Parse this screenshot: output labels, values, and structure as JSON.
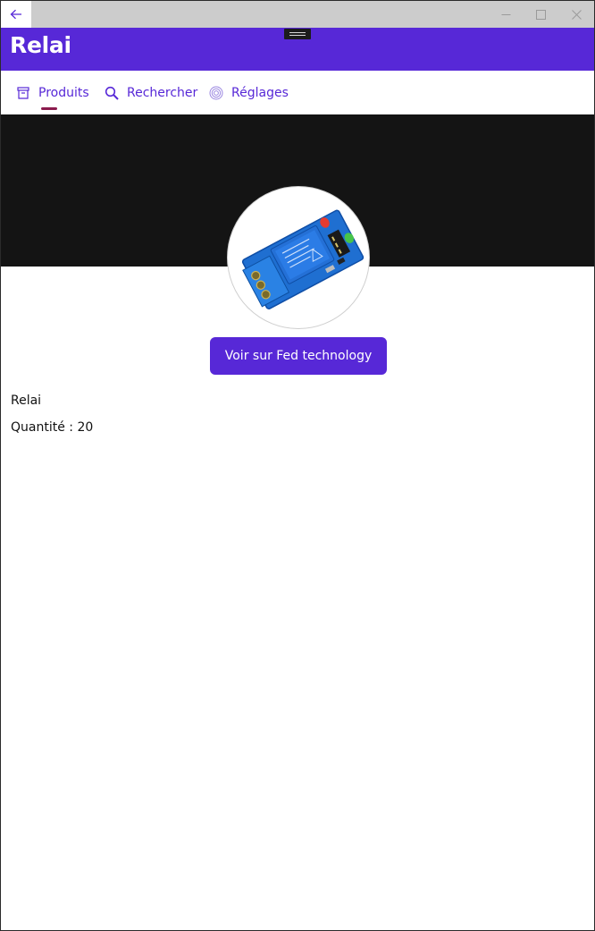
{
  "window": {
    "back_label": "←",
    "minimize_label": "─",
    "maximize_label": "☐",
    "close_label": "✕"
  },
  "header": {
    "title": "Relai"
  },
  "tabs": [
    {
      "label": "Produits",
      "icon": "package-icon",
      "selected": true
    },
    {
      "label": "Rechercher",
      "icon": "search-icon",
      "selected": false
    },
    {
      "label": "Réglages",
      "icon": "settings-icon",
      "selected": false
    }
  ],
  "product": {
    "image": "relay-module-image",
    "cta_label": "Voir sur Fed technology",
    "name": "Relai",
    "quantity": "Quantité : 20"
  },
  "colors": {
    "accent": "#5728d7",
    "tab_indicator": "#8b1a4d",
    "hero_background": "#141414"
  }
}
